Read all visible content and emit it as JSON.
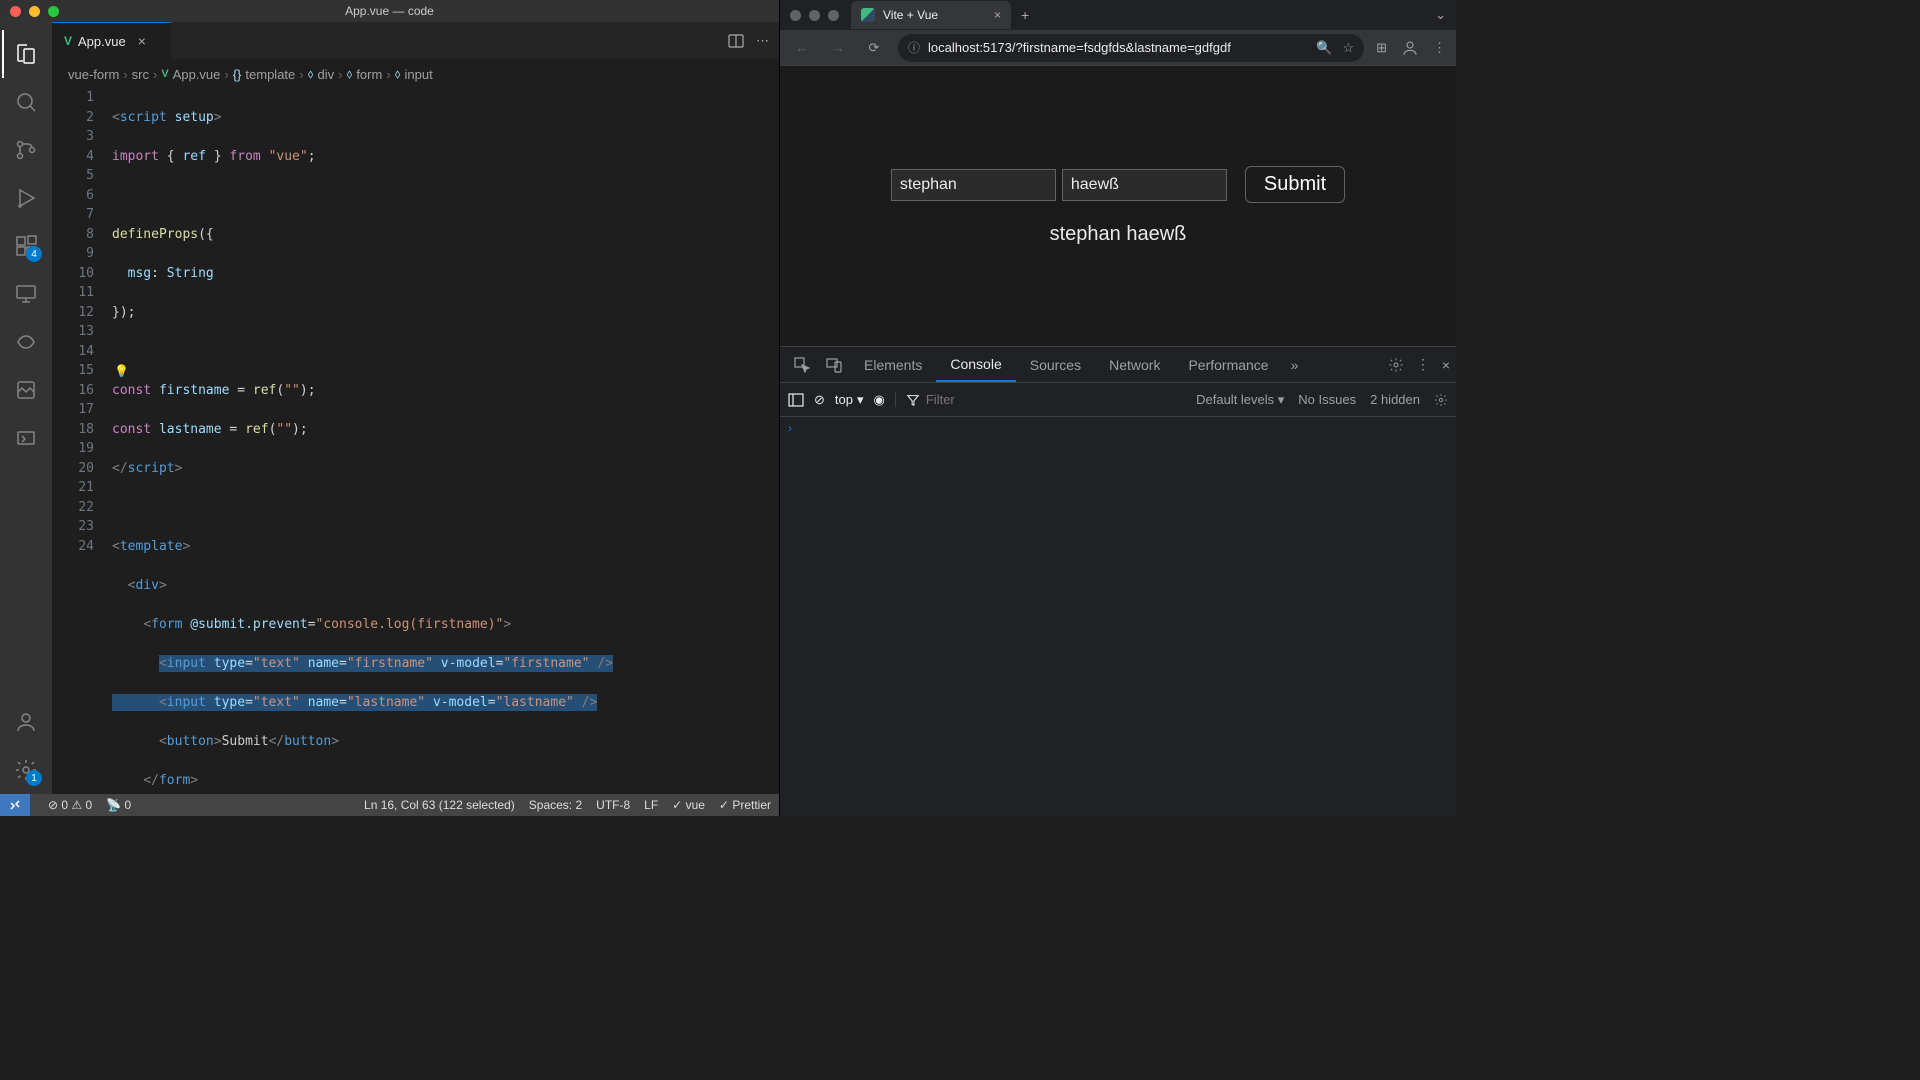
{
  "vscode": {
    "window_title": "App.vue — code",
    "tab": {
      "label": "App.vue"
    },
    "activity_badges": {
      "extensions": "4",
      "settings": "1"
    },
    "breadcrumbs": [
      "vue-form",
      "src",
      "App.vue",
      "template",
      "div",
      "form",
      "input"
    ],
    "bc_icons": [
      "",
      "",
      "vue",
      "{}",
      "<>",
      "<>",
      "<>"
    ],
    "statusbar": {
      "errors": "0",
      "warnings": "0",
      "ports": "0",
      "cursor": "Ln 16, Col 63 (122 selected)",
      "spaces": "Spaces: 2",
      "encoding": "UTF-8",
      "eol": "LF",
      "lang": "vue",
      "prettier": "Prettier"
    },
    "code_lines": 24
  },
  "browser": {
    "tab_title": "Vite + Vue",
    "url": "localhost:5173/?firstname=fsdgfds&lastname=gdfgdf",
    "form": {
      "firstname": "stephan",
      "lastname": "haewß",
      "submit_label": "Submit"
    },
    "output": "stephan haewß"
  },
  "devtools": {
    "tabs": [
      "Elements",
      "Console",
      "Sources",
      "Network",
      "Performance"
    ],
    "active_tab": "Console",
    "context": "top",
    "filter_placeholder": "Filter",
    "levels": "Default levels",
    "issues": "No Issues",
    "hidden": "2 hidden"
  }
}
